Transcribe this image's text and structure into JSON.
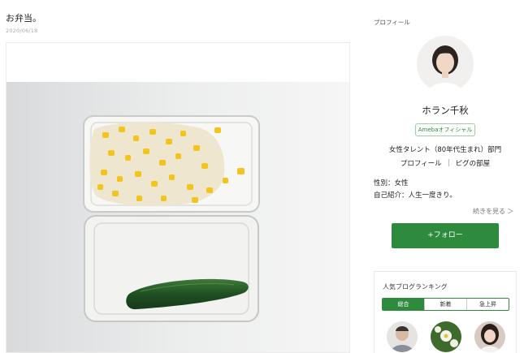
{
  "post": {
    "title": "お弁当。",
    "date": "2020/06/18"
  },
  "sidebar": {
    "heading": "プロフィール",
    "name": "ホラン千秋",
    "badge": "Amebaオフィシャル",
    "category": "女性タレント（80年代生まれ）部門",
    "links": [
      "プロフィール",
      "ピグの部屋"
    ],
    "gender": "性別：女性",
    "intro": "自己紹介：人生一度きり。",
    "more": "続きを見る ＞",
    "follow": "+フォロー"
  },
  "ranking": {
    "title": "人気ブログランキング",
    "tabs": [
      "総合",
      "新着",
      "急上昇"
    ]
  },
  "colors": {
    "accent_green": "#2e8b3d",
    "badge_border": "#9ccfa4"
  }
}
